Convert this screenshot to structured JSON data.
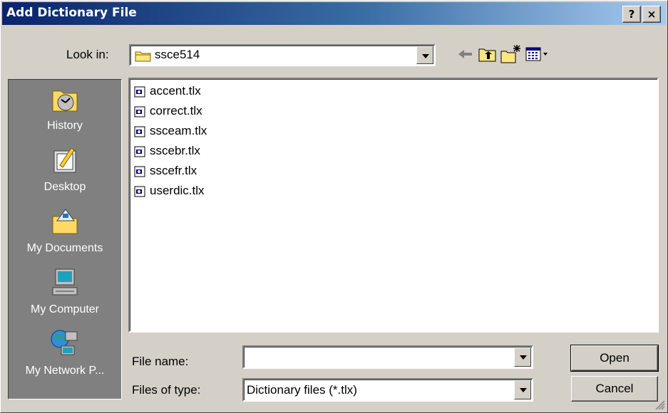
{
  "window": {
    "title": "Add Dictionary File",
    "help_label": "?",
    "close_label": "×"
  },
  "lookin": {
    "label": "Look in:",
    "value": "ssce514"
  },
  "toolbar": {
    "icons": [
      "back-arrow-icon",
      "up-folder-icon",
      "new-folder-icon",
      "view-menu-icon"
    ]
  },
  "places": [
    {
      "label": "History",
      "icon": "history-icon"
    },
    {
      "label": "Desktop",
      "icon": "desktop-icon"
    },
    {
      "label": "My Documents",
      "icon": "my-documents-icon"
    },
    {
      "label": "My Computer",
      "icon": "my-computer-icon"
    },
    {
      "label": "My Network P...",
      "icon": "my-network-places-icon"
    }
  ],
  "files": [
    "accent.tlx",
    "correct.tlx",
    "ssceam.tlx",
    "sscebr.tlx",
    "sscefr.tlx",
    "userdic.tlx"
  ],
  "filename": {
    "label": "File name:",
    "value": ""
  },
  "filetype": {
    "label": "Files of type:",
    "value": "Dictionary files (*.tlx)"
  },
  "buttons": {
    "open": "Open",
    "cancel": "Cancel"
  },
  "colors": {
    "title_start": "#0a246a",
    "title_end": "#a6caf0",
    "face": "#d4d0c8",
    "places_bg": "#808080"
  }
}
